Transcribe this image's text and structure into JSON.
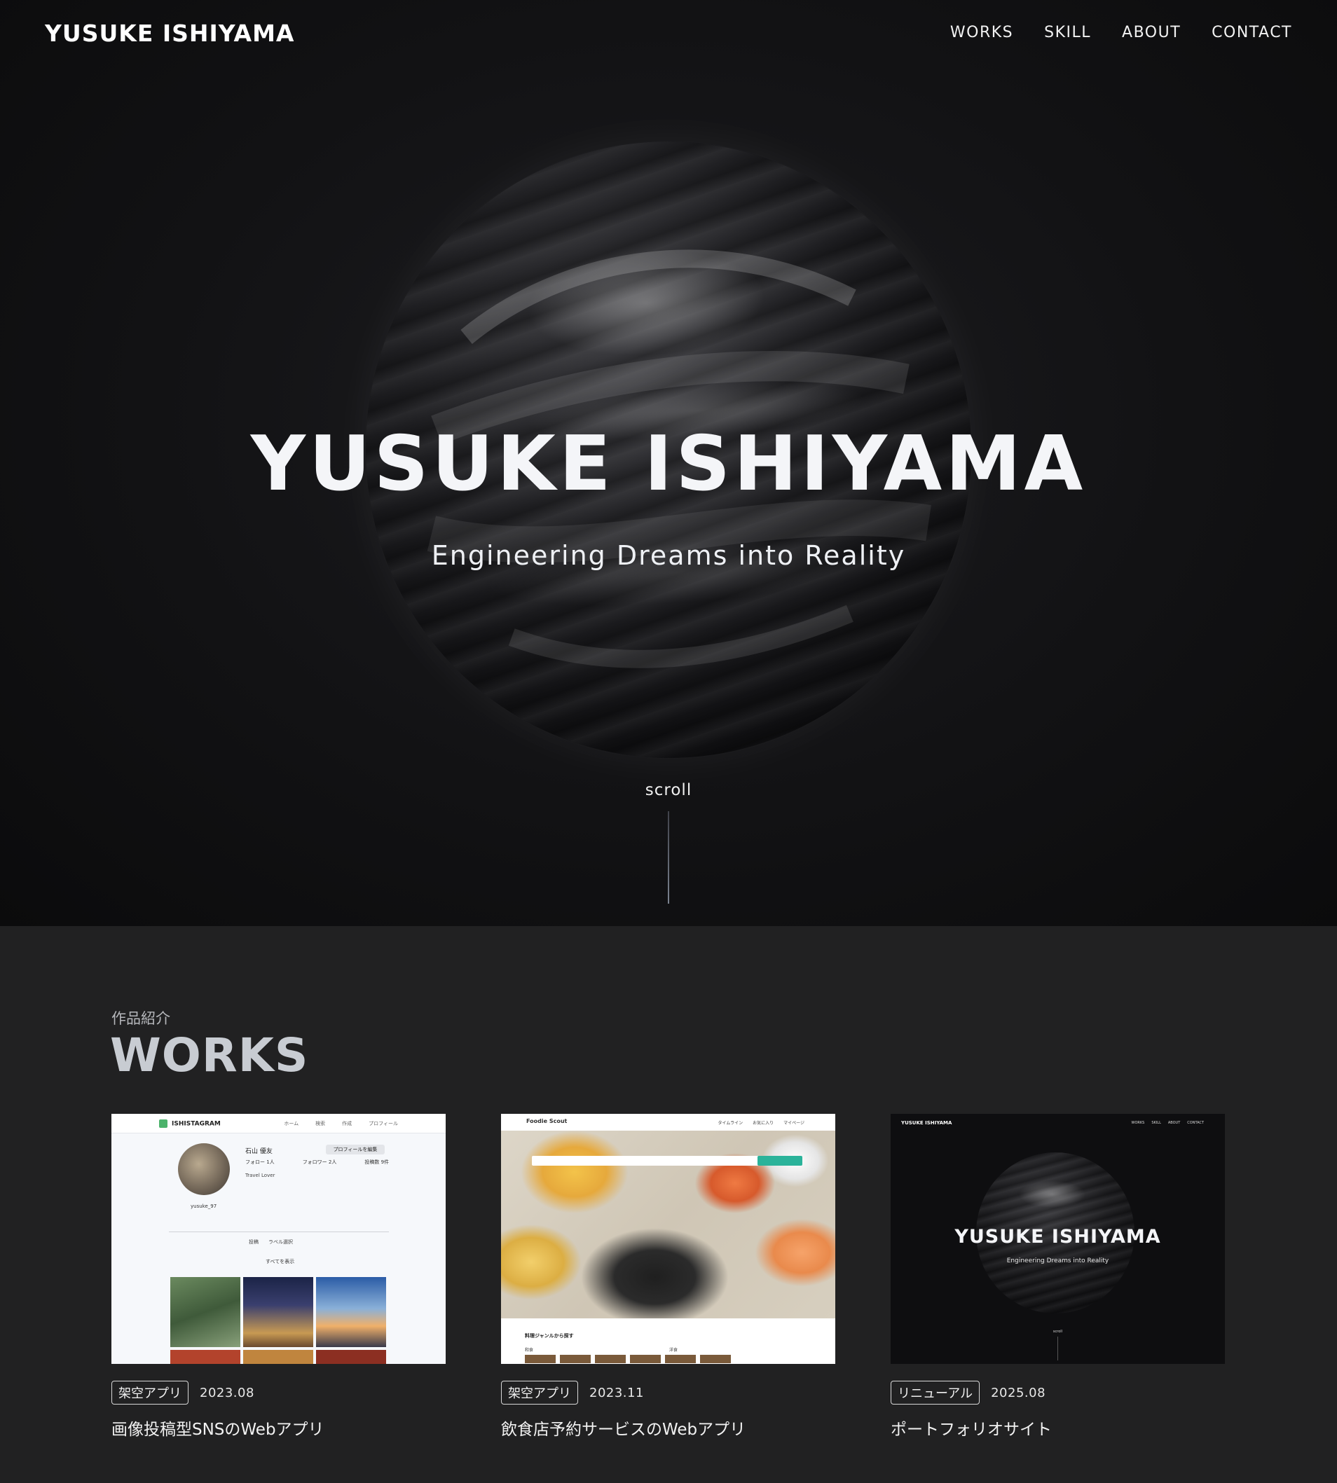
{
  "header": {
    "logo": "YUSUKE ISHIYAMA",
    "nav": [
      "WORKS",
      "SKILL",
      "ABOUT",
      "CONTACT"
    ]
  },
  "hero": {
    "title": "YUSUKE ISHIYAMA",
    "subtitle": "Engineering Dreams into Reality",
    "scroll_label": "scroll"
  },
  "works": {
    "subheading": "作品紹介",
    "heading": "WORKS",
    "items": [
      {
        "tag": "架空アプリ",
        "date": "2023.08",
        "title": "画像投稿型SNSのWebアプリ",
        "preview": {
          "app_name": "ISHISTAGRAM",
          "nav": [
            "ホーム",
            "検索",
            "作成",
            "プロフィール"
          ],
          "profile_name": "石山 優友",
          "edit_button": "プロフィールを編集",
          "follow": "フォロー 1人",
          "followers": "フォロワー 2人",
          "posts": "投稿数 9件",
          "bio": "Travel Lover",
          "username": "yusuke_97",
          "tab_posts": "投稿",
          "tab_labels": "ラベル選択",
          "show_all": "すべてを表示"
        }
      },
      {
        "tag": "架空アプリ",
        "date": "2023.11",
        "title": "飲食店予約サービスのWebアプリ",
        "preview": {
          "app_name": "Foodie Scout",
          "nav": [
            "タイムライン",
            "お気に入り",
            "マイページ"
          ],
          "genre_heading": "料理ジャンルから探す",
          "genre_a": "和食",
          "genre_b": "洋食"
        }
      },
      {
        "tag": "リニューアル",
        "date": "2025.08",
        "title": "ポートフォリオサイト",
        "preview": {
          "logo": "YUSUKE ISHIYAMA",
          "nav": [
            "WORKS",
            "SKILL",
            "ABOUT",
            "CONTACT"
          ],
          "title": "YUSUKE ISHIYAMA",
          "subtitle": "Engineering Dreams into Reality",
          "scroll": "scroll"
        }
      }
    ]
  },
  "colors": {
    "hero_bg": "#0e0e10",
    "section_bg": "#212122",
    "heading_gray": "#c8ccd2",
    "accent_green": "#2bb39a"
  }
}
